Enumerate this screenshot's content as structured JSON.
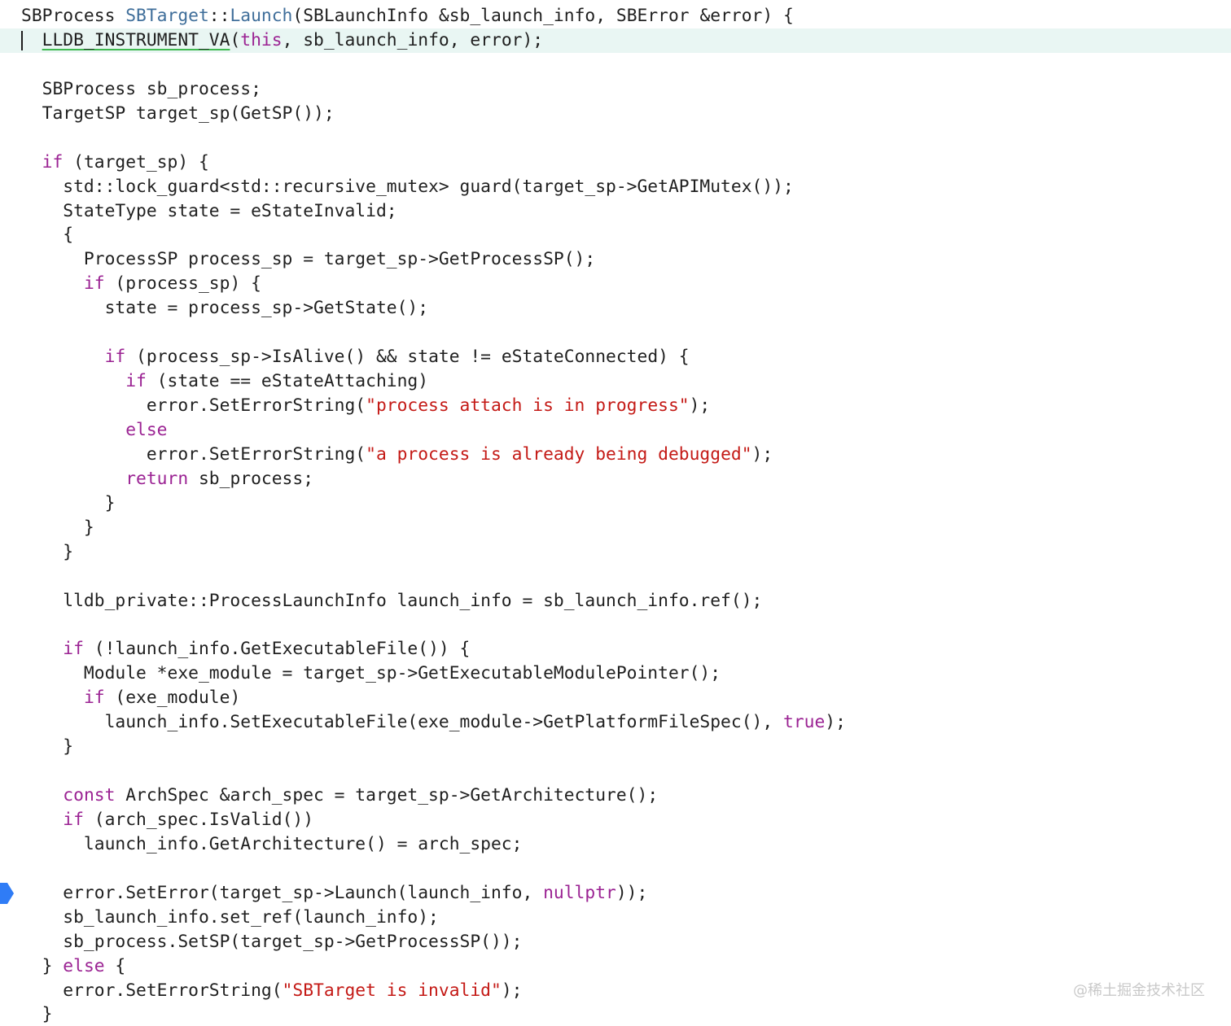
{
  "colors": {
    "keyword": "#9b2393",
    "string": "#c41a16",
    "type_ref": "#3f6e9a",
    "plain": "#1f1f1f",
    "current_line_bg": "#e9f6f3",
    "breakpoint": "#2f7cf6"
  },
  "editor": {
    "current_line": 2,
    "breakpoint_line": 37,
    "breakpoint_icon": "breakpoint-marker-icon",
    "lines": [
      [
        {
          "t": "SBProcess ",
          "c": "plain"
        },
        {
          "t": "SBTarget",
          "c": "typ"
        },
        {
          "t": "::",
          "c": "plain"
        },
        {
          "t": "Launch",
          "c": "fn"
        },
        {
          "t": "(SBLaunchInfo &sb_launch_info, SBError &error) {",
          "c": "plain"
        }
      ],
      [
        {
          "t": "  ",
          "c": "plain"
        },
        {
          "t": "LLDB_INSTRUMENT_VA",
          "c": "macro"
        },
        {
          "t": "(",
          "c": "plain"
        },
        {
          "t": "this",
          "c": "kw"
        },
        {
          "t": ", sb_launch_info, error);",
          "c": "plain"
        }
      ],
      [],
      [
        {
          "t": "  SBProcess sb_process;",
          "c": "plain"
        }
      ],
      [
        {
          "t": "  TargetSP target_sp(GetSP());",
          "c": "plain"
        }
      ],
      [],
      [
        {
          "t": "  ",
          "c": "plain"
        },
        {
          "t": "if",
          "c": "kw"
        },
        {
          "t": " (target_sp) {",
          "c": "plain"
        }
      ],
      [
        {
          "t": "    std::lock_guard<std::recursive_mutex> guard(target_sp->GetAPIMutex());",
          "c": "plain"
        }
      ],
      [
        {
          "t": "    StateType state = eStateInvalid;",
          "c": "plain"
        }
      ],
      [
        {
          "t": "    {",
          "c": "plain"
        }
      ],
      [
        {
          "t": "      ProcessSP process_sp = target_sp->GetProcessSP();",
          "c": "plain"
        }
      ],
      [
        {
          "t": "      ",
          "c": "plain"
        },
        {
          "t": "if",
          "c": "kw"
        },
        {
          "t": " (process_sp) {",
          "c": "plain"
        }
      ],
      [
        {
          "t": "        state = process_sp->GetState();",
          "c": "plain"
        }
      ],
      [],
      [
        {
          "t": "        ",
          "c": "plain"
        },
        {
          "t": "if",
          "c": "kw"
        },
        {
          "t": " (process_sp->IsAlive() && state != eStateConnected) {",
          "c": "plain"
        }
      ],
      [
        {
          "t": "          ",
          "c": "plain"
        },
        {
          "t": "if",
          "c": "kw"
        },
        {
          "t": " (state == eStateAttaching)",
          "c": "plain"
        }
      ],
      [
        {
          "t": "            error.SetErrorString(",
          "c": "plain"
        },
        {
          "t": "\"process attach is in progress\"",
          "c": "str"
        },
        {
          "t": ");",
          "c": "plain"
        }
      ],
      [
        {
          "t": "          ",
          "c": "plain"
        },
        {
          "t": "else",
          "c": "kw"
        }
      ],
      [
        {
          "t": "            error.SetErrorString(",
          "c": "plain"
        },
        {
          "t": "\"a process is already being debugged\"",
          "c": "str"
        },
        {
          "t": ");",
          "c": "plain"
        }
      ],
      [
        {
          "t": "          ",
          "c": "plain"
        },
        {
          "t": "return",
          "c": "kw"
        },
        {
          "t": " sb_process;",
          "c": "plain"
        }
      ],
      [
        {
          "t": "        }",
          "c": "plain"
        }
      ],
      [
        {
          "t": "      }",
          "c": "plain"
        }
      ],
      [
        {
          "t": "    }",
          "c": "plain"
        }
      ],
      [],
      [
        {
          "t": "    lldb_private::ProcessLaunchInfo launch_info = sb_launch_info.ref();",
          "c": "plain"
        }
      ],
      [],
      [
        {
          "t": "    ",
          "c": "plain"
        },
        {
          "t": "if",
          "c": "kw"
        },
        {
          "t": " (!launch_info.GetExecutableFile()) {",
          "c": "plain"
        }
      ],
      [
        {
          "t": "      Module *exe_module = target_sp->GetExecutableModulePointer();",
          "c": "plain"
        }
      ],
      [
        {
          "t": "      ",
          "c": "plain"
        },
        {
          "t": "if",
          "c": "kw"
        },
        {
          "t": " (exe_module)",
          "c": "plain"
        }
      ],
      [
        {
          "t": "        launch_info.SetExecutableFile(exe_module->GetPlatformFileSpec(), ",
          "c": "plain"
        },
        {
          "t": "true",
          "c": "kw"
        },
        {
          "t": ");",
          "c": "plain"
        }
      ],
      [
        {
          "t": "    }",
          "c": "plain"
        }
      ],
      [],
      [
        {
          "t": "    ",
          "c": "plain"
        },
        {
          "t": "const",
          "c": "kw"
        },
        {
          "t": " ArchSpec &arch_spec = target_sp->GetArchitecture();",
          "c": "plain"
        }
      ],
      [
        {
          "t": "    ",
          "c": "plain"
        },
        {
          "t": "if",
          "c": "kw"
        },
        {
          "t": " (arch_spec.IsValid())",
          "c": "plain"
        }
      ],
      [
        {
          "t": "      launch_info.GetArchitecture() = arch_spec;",
          "c": "plain"
        }
      ],
      [],
      [
        {
          "t": "    error.SetError(target_sp->Launch(launch_info, ",
          "c": "plain"
        },
        {
          "t": "nullptr",
          "c": "kw"
        },
        {
          "t": "));",
          "c": "plain"
        }
      ],
      [
        {
          "t": "    sb_launch_info.set_ref(launch_info);",
          "c": "plain"
        }
      ],
      [
        {
          "t": "    sb_process.SetSP(target_sp->GetProcessSP());",
          "c": "plain"
        }
      ],
      [
        {
          "t": "  } ",
          "c": "plain"
        },
        {
          "t": "else",
          "c": "kw"
        },
        {
          "t": " {",
          "c": "plain"
        }
      ],
      [
        {
          "t": "    error.SetErrorString(",
          "c": "plain"
        },
        {
          "t": "\"SBTarget is invalid\"",
          "c": "str"
        },
        {
          "t": ");",
          "c": "plain"
        }
      ],
      [
        {
          "t": "  }",
          "c": "plain"
        }
      ]
    ]
  },
  "watermark": "@稀土掘金技术社区"
}
